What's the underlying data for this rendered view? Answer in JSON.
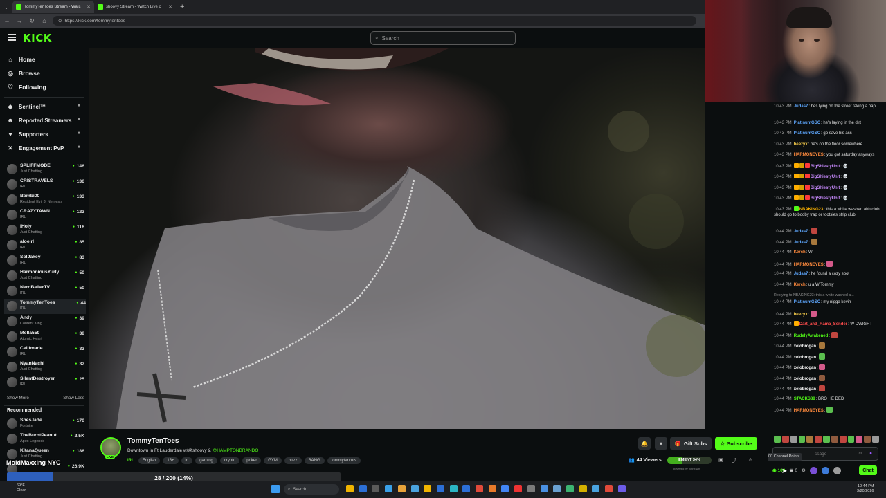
{
  "browser": {
    "tabs": [
      {
        "title": "TommyTenToes Stream - Watc",
        "active": true
      },
      {
        "title": "shoovy Stream - Watch Live o",
        "active": false
      }
    ],
    "url": "https://kick.com/tommytentoes"
  },
  "header": {
    "logo": "KICK",
    "search_placeholder": "Search"
  },
  "sidebar": {
    "nav": [
      {
        "label": "Home",
        "icon": "home-icon"
      },
      {
        "label": "Browse",
        "icon": "compass-icon"
      },
      {
        "label": "Following",
        "icon": "heart-icon"
      }
    ],
    "extras": [
      {
        "label": "Sentinel™",
        "icon": "shield-icon"
      },
      {
        "label": "Reported Streamers",
        "icon": "people-icon"
      },
      {
        "label": "Supporters",
        "icon": "heart-icon"
      },
      {
        "label": "Engagement PvP",
        "icon": "versus-icon"
      }
    ],
    "following": [
      {
        "name": "SPLIFFMODE",
        "category": "Just Chatting",
        "viewers": "146"
      },
      {
        "name": "CRISTRAVELS",
        "category": "IRL",
        "viewers": "136"
      },
      {
        "name": "Bambi00",
        "category": "Resident Evil 3: Nemesis",
        "viewers": "133"
      },
      {
        "name": "CRAZYTAWN",
        "category": "IRL",
        "viewers": "123"
      },
      {
        "name": "lHoly",
        "category": "Just Chatting",
        "viewers": "116"
      },
      {
        "name": "aloeirl",
        "category": "IRL",
        "viewers": "85"
      },
      {
        "name": "SolJakey",
        "category": "IRL",
        "viewers": "83"
      },
      {
        "name": "HarmoniousYurly",
        "category": "Just Chatting",
        "viewers": "50"
      },
      {
        "name": "NerdBallerTV",
        "category": "IRL",
        "viewers": "50"
      },
      {
        "name": "TommyTenToes",
        "category": "IRL",
        "viewers": "44"
      },
      {
        "name": "Andy",
        "category": "Content King",
        "viewers": "39"
      },
      {
        "name": "Mella559",
        "category": "Atomic Heart",
        "viewers": "38"
      },
      {
        "name": "Cellfmade",
        "category": "IRL",
        "viewers": "33"
      },
      {
        "name": "NyanNachi",
        "category": "Just Chatting",
        "viewers": "32"
      },
      {
        "name": "SilentDestroyer",
        "category": "IRL",
        "viewers": "25"
      }
    ],
    "show_more": "Show More",
    "show_less": "Show Less",
    "recommended_heading": "Recommended",
    "recommended": [
      {
        "name": "ShesJade",
        "category": "Fortnite",
        "viewers": "170"
      },
      {
        "name": "TheBurntPeanut",
        "category": "Apex Legends",
        "viewers": "2.5K"
      },
      {
        "name": "KitanaQueen",
        "category": "Just Chatting",
        "viewers": "186"
      },
      {
        "name": "",
        "category": "",
        "viewers": "26.9K"
      }
    ]
  },
  "stream": {
    "streamer": "TommyTenToes",
    "live_label": "LIVE",
    "title_text": "Downtown in Ft Lauderdale w/@shoovy &",
    "title_mention": "@HAMPTONBRANDO",
    "category": "IRL",
    "tags": [
      "English",
      "18+",
      "irl",
      "gaming",
      "crypto",
      "poker",
      "GYM",
      "huzz",
      "BANG",
      "tommytenruts"
    ],
    "viewers": "44 Viewers",
    "hype": "EMENT 34%",
    "hype_level": 0.34,
    "powered_by": "powered by botrix.wtf",
    "gift_subs": "Gift Subs",
    "subscribe": "Subscribe"
  },
  "chat": {
    "messages": [
      {
        "time": "10:43 PM",
        "user": "Judas7",
        "color": "#5fa8ff",
        "text": "hes lying on the street taking a nap",
        "badges": []
      },
      {
        "time": "10:43 PM",
        "user": "PlatinumGSC",
        "color": "#5fa8ff",
        "text": "he's laying in the dirt",
        "badges": []
      },
      {
        "time": "10:43 PM",
        "user": "PlatinumGSC",
        "color": "#5fa8ff",
        "text": "go save his ass",
        "badges": []
      },
      {
        "time": "10:43 PM",
        "user": "beezyx",
        "color": "#ffd34d",
        "text": "he's on the floor somewhere",
        "badges": []
      },
      {
        "time": "10:43 PM",
        "user": "HARMONEYES",
        "color": "#ff8a3d",
        "text": "you got saturday anyways",
        "badges": []
      },
      {
        "time": "10:43 PM",
        "user": "BigShiestyUnit",
        "color": "#c98bff",
        "text": "💀",
        "badges": [
          "#ffae00",
          "#d6a000",
          "#ff3b3b"
        ]
      },
      {
        "time": "10:43 PM",
        "user": "BigShiestyUnit",
        "color": "#c98bff",
        "text": "💀",
        "badges": [
          "#ffae00",
          "#d6a000",
          "#ff3b3b"
        ]
      },
      {
        "time": "10:43 PM",
        "user": "BigShiestyUnit",
        "color": "#c98bff",
        "text": "💀",
        "badges": [
          "#ffae00",
          "#d6a000",
          "#ff3b3b"
        ]
      },
      {
        "time": "10:43 PM",
        "user": "BigShiestyUnit",
        "color": "#c98bff",
        "text": "💀",
        "badges": [
          "#ffae00",
          "#d6a000",
          "#ff3b3b"
        ]
      },
      {
        "time": "10:43 PM",
        "user": "NBAKING23",
        "color": "#ffb400",
        "text": "this a white washed ahh club should go to booby trap or tootsies strip club",
        "badges": [
          "#53fc18"
        ]
      },
      {
        "time": "10:44 PM",
        "user": "Judas7",
        "color": "#5fa8ff",
        "text": "",
        "badges": [],
        "emote": true
      },
      {
        "time": "10:44 PM",
        "user": "Judas7",
        "color": "#5fa8ff",
        "text": "",
        "badges": [],
        "emote": true
      },
      {
        "time": "10:44 PM",
        "user": "Kerch",
        "color": "#ff8a3d",
        "text": "W",
        "badges": []
      },
      {
        "time": "10:44 PM",
        "user": "HARMONEYES",
        "color": "#ff8a3d",
        "text": "",
        "badges": [],
        "emote": true
      },
      {
        "time": "10:44 PM",
        "user": "Judas7",
        "color": "#5fa8ff",
        "text": "he found a cozy spot",
        "badges": []
      },
      {
        "time": "10:44 PM",
        "user": "Kerch",
        "color": "#ff8a3d",
        "text": "u a W Tommy",
        "badges": []
      },
      {
        "reply": "Replying to NBAKING23: this a white washed a..."
      },
      {
        "time": "10:44 PM",
        "user": "PlatinumGSC",
        "color": "#5fa8ff",
        "text": "my nigga kevin",
        "badges": []
      },
      {
        "time": "10:44 PM",
        "user": "beezyx",
        "color": "#ffd34d",
        "text": "",
        "badges": [],
        "emote": true
      },
      {
        "time": "10:44 PM",
        "user": "Dart_and_Rama_Sender",
        "color": "#ff4d4d",
        "text": "W DWIGHT",
        "badges": [
          "#ffae00"
        ]
      },
      {
        "time": "10:44 PM",
        "user": "RudelyAwakened",
        "color": "#53fc18",
        "text": "",
        "badges": [],
        "emote": true
      },
      {
        "time": "10:44 PM",
        "user": "xelobrogan",
        "color": "#ffffff",
        "text": "",
        "badges": [],
        "emote": true
      },
      {
        "time": "10:44 PM",
        "user": "xelobrogan",
        "color": "#ffffff",
        "text": "",
        "badges": [],
        "emote": true
      },
      {
        "time": "10:44 PM",
        "user": "xelobrogan",
        "color": "#ffffff",
        "text": "",
        "badges": [],
        "emote": true
      },
      {
        "time": "10:44 PM",
        "user": "xelobrogan",
        "color": "#ffffff",
        "text": "",
        "badges": [],
        "emote": true
      },
      {
        "time": "10:44 PM",
        "user": "xelobrogan",
        "color": "#ffffff",
        "text": "",
        "badges": [],
        "emote": true
      },
      {
        "time": "10:44 PM",
        "user": "STACKS88",
        "color": "#53fc18",
        "text": "BRO HE DED",
        "badges": []
      },
      {
        "time": "10:44 PM",
        "user": "HARMONEYES",
        "color": "#ff8a3d",
        "text": "",
        "badges": [],
        "emote": true
      }
    ],
    "input_placeholder": "ssage",
    "tooltip": "100 Channel Points",
    "points": "100",
    "subs_count": "0",
    "send_label": "Chat"
  },
  "overlay": {
    "title": "MoldMaxxing NYC",
    "progress_text": "28 / 200 (14%)",
    "progress": 0.14
  },
  "taskbar": {
    "weather_temp": "69°F",
    "weather_text": "Clear",
    "search": "Search",
    "time": "10:44 PM",
    "date": "3/20/2026"
  },
  "colors": {
    "accent": "#53fc18",
    "background": "#0b0e0f"
  }
}
